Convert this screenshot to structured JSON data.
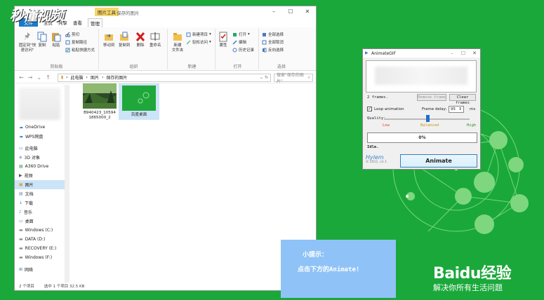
{
  "watermark": "秒懂视频",
  "explorer": {
    "context_tab": "图片工具",
    "window_title": "保存的图片",
    "tabs": [
      "文件",
      "主页",
      "共享",
      "查看",
      "管理"
    ],
    "ribbon": {
      "clipboard": {
        "label": "剪贴板",
        "pin": "固定到\"快速访问\"",
        "copy": "复制",
        "paste": "粘贴",
        "cut": "剪切",
        "copy_path": "复制路径",
        "paste_shortcut": "粘贴快捷方式"
      },
      "organize": {
        "label": "组织",
        "move_to": "移动到",
        "copy_to": "复制到",
        "delete": "删除",
        "rename": "重命名"
      },
      "new": {
        "label": "新建",
        "new_folder": "新建\n文件夹",
        "new_item": "新建项目",
        "easy_access": "轻松访问"
      },
      "open": {
        "label": "打开",
        "properties": "属性",
        "open": "打开",
        "edit": "编辑",
        "history": "历史记录"
      },
      "select": {
        "label": "选择",
        "select_all": "全部选择",
        "select_none": "全部取消",
        "invert": "反向选择"
      }
    },
    "breadcrumb": [
      "此电脑",
      "图片",
      "保存的图片"
    ],
    "search_placeholder": "搜索\"保存的图片\"",
    "nav": [
      {
        "label": "OneDrive",
        "icon": "cloud-icon"
      },
      {
        "label": "WPS网盘",
        "icon": "cloud-icon"
      },
      {
        "label": "此电脑",
        "icon": "computer-icon"
      },
      {
        "label": "3D 对象",
        "icon": "cube-icon"
      },
      {
        "label": "A360 Drive",
        "icon": "drive-icon"
      },
      {
        "label": "视频",
        "icon": "video-icon"
      },
      {
        "label": "图片",
        "icon": "pictures-icon"
      },
      {
        "label": "文档",
        "icon": "documents-icon"
      },
      {
        "label": "下载",
        "icon": "download-icon"
      },
      {
        "label": "音乐",
        "icon": "music-icon"
      },
      {
        "label": "桌面",
        "icon": "desktop-icon"
      },
      {
        "label": "Windows (C:)",
        "icon": "disk-icon"
      },
      {
        "label": "DATA (D:)",
        "icon": "disk-icon"
      },
      {
        "label": "RECOVERY (E:)",
        "icon": "disk-icon"
      },
      {
        "label": "Windows (F:)",
        "icon": "disk-icon"
      },
      {
        "label": "网络",
        "icon": "network-icon"
      }
    ],
    "files": [
      {
        "name": "B940423_105941865000_2",
        "line1": "B940423_10594",
        "line2": "1865000_2"
      },
      {
        "name": "百度桌面",
        "line1": "百度桌面",
        "line2": ""
      }
    ],
    "status": {
      "count": "2 个项目",
      "selection": "选中 1 个项目  32.5 KB"
    }
  },
  "animategif": {
    "title": "AnimateGIF",
    "frames": "2 frames.",
    "remove_frame": "Remove frame",
    "clear_frames": "Clear frames",
    "loop_label": "Loop animation",
    "loop_checked": true,
    "frame_delay_label": "Frame delay:",
    "frame_delay_value": "95",
    "frame_delay_unit": "ms",
    "quality_label": "Quality:",
    "quality_low": "Low",
    "quality_balanced": "Balanced",
    "quality_high": "High",
    "progress_text": "0%",
    "status": "Idle.",
    "logo": "Hylem",
    "version": "© 2011, v1.1",
    "animate_button": "Animate"
  },
  "hint": {
    "title": "小提示：",
    "body": "点击下方的Animate!"
  },
  "baidu": {
    "logo": "Baidu经验",
    "slogan": "解决你所有生活问题"
  }
}
